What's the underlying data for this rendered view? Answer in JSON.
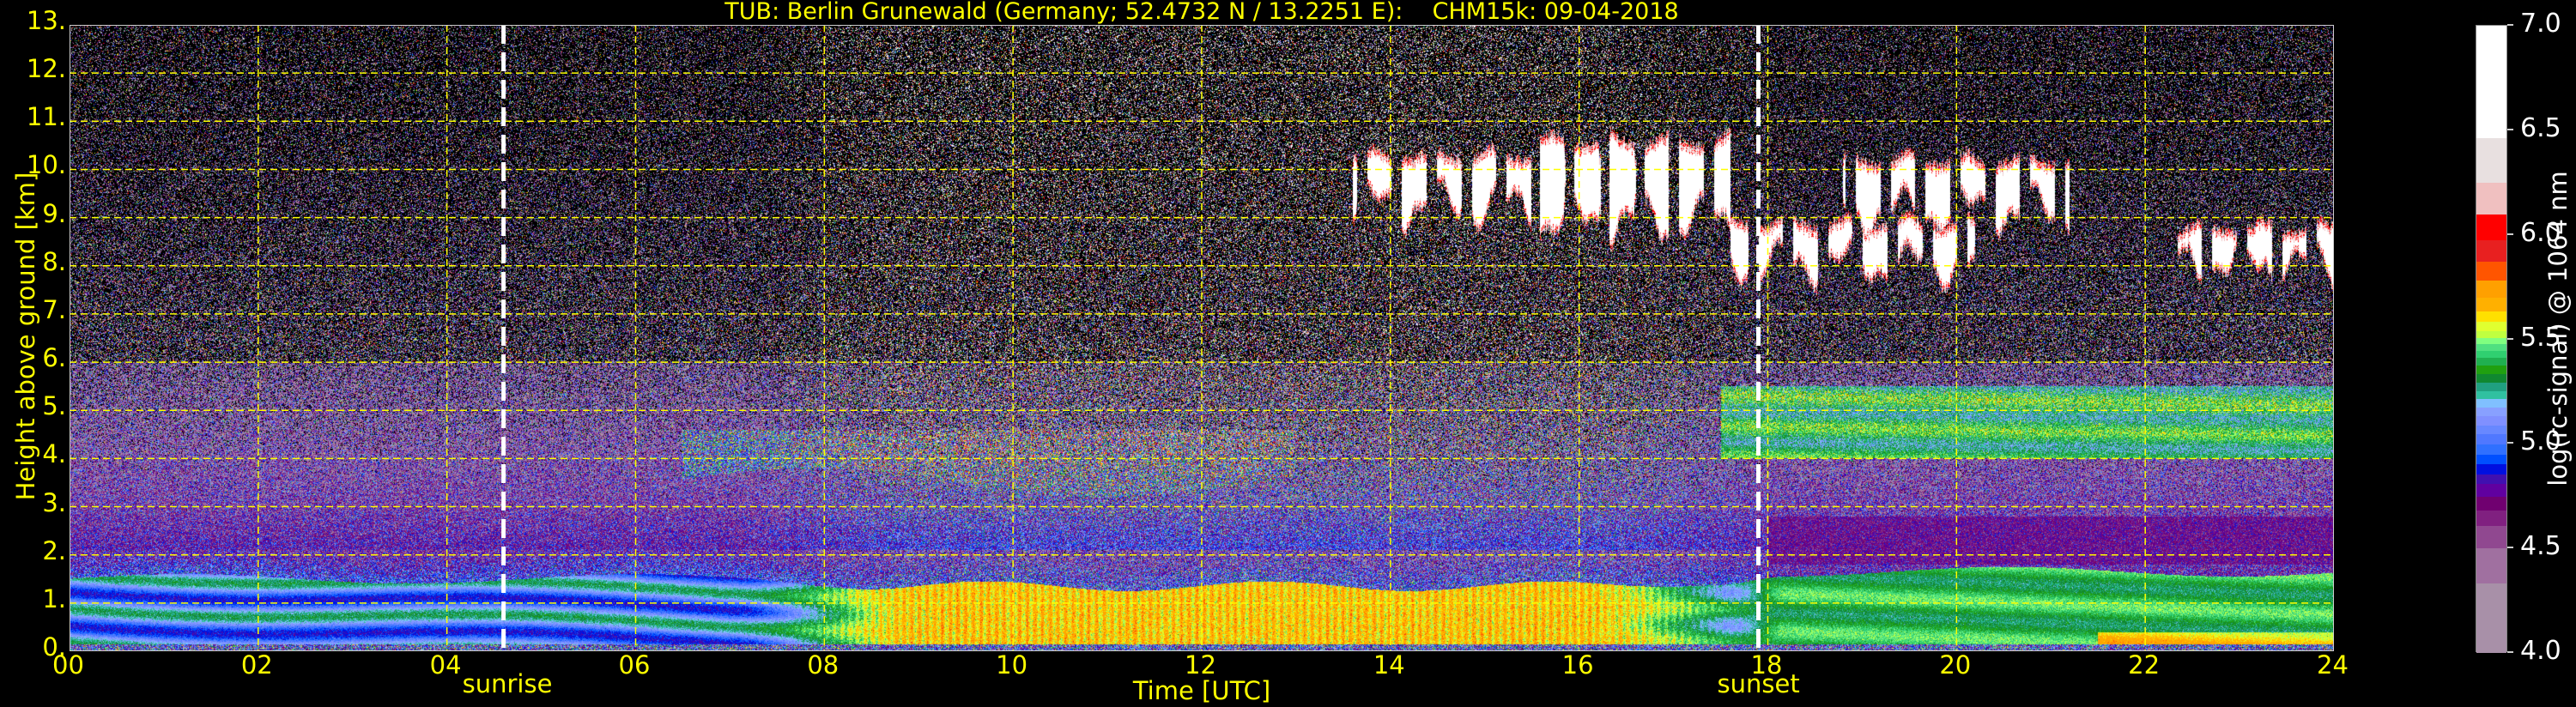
{
  "chart_data": {
    "type": "heatmap",
    "title": "TUB: Berlin Grunewald (Germany; 52.4732 N / 13.2251 E):    CHM15k: 09-04-2018",
    "xlabel": "Time [UTC]",
    "ylabel": "Height above ground [km]",
    "xlim": [
      0,
      24
    ],
    "ylim": [
      0,
      13
    ],
    "grid": true,
    "xticks": [
      0,
      2,
      4,
      6,
      8,
      10,
      12,
      14,
      16,
      18,
      20,
      22,
      24
    ],
    "xtick_labels": [
      "00",
      "02",
      "04",
      "06",
      "08",
      "10",
      "12",
      "14",
      "16",
      "18",
      "20",
      "22",
      "24"
    ],
    "yticks": [
      0,
      1,
      2,
      3,
      4,
      5,
      6,
      7,
      8,
      9,
      10,
      11,
      12,
      13
    ],
    "ytick_labels": [
      "0.",
      "1.",
      "2.",
      "3.",
      "4.",
      "5.",
      "6.",
      "7.",
      "8.",
      "9.",
      "10.",
      "11.",
      "12.",
      "13."
    ],
    "annotations": [
      {
        "label": "sunrise",
        "x": 4.6
      },
      {
        "label": "sunset",
        "x": 17.9
      }
    ],
    "colorbar": {
      "label": "log(rc-signal) @ 1064 nm",
      "vmin": 4.0,
      "vmax": 7.0,
      "ticks": [
        4.0,
        4.5,
        5.0,
        5.5,
        6.0,
        6.5,
        7.0
      ],
      "tick_labels": [
        "4.0",
        "4.5",
        "5.0",
        "5.5",
        "6.0",
        "6.5",
        "7.0"
      ],
      "bounds": [
        4.0,
        4.335,
        4.503,
        4.611,
        4.684,
        4.749,
        4.809,
        4.857,
        4.904,
        4.952,
        5.0,
        5.047,
        5.09,
        5.133,
        5.176,
        5.215,
        5.254,
        5.293,
        5.336,
        5.375,
        5.414,
        5.446,
        5.478,
        5.509,
        5.543,
        5.586,
        5.634,
        5.7,
        5.785,
        5.873,
        5.975,
        6.098,
        6.249,
        6.465,
        7.0
      ],
      "colors": [
        "#a890a8",
        "#a070a0",
        "#904890",
        "#802080",
        "#700070",
        "#6000a0",
        "#4010b0",
        "#0010e0",
        "#0050ff",
        "#3070ff",
        "#5078ff",
        "#6888ff",
        "#8090ff",
        "#88a0ff",
        "#80c0ff",
        "#30c0a0",
        "#20a080",
        "#108830",
        "#20a010",
        "#20b050",
        "#30d070",
        "#50e080",
        "#80ff80",
        "#c0ff40",
        "#e0ff30",
        "#ffe000",
        "#ffb000",
        "#ffa000",
        "#ff5500",
        "#e82020",
        "#ff0000",
        "#f0c0c0",
        "#e8e0e0",
        "#ffffff"
      ]
    },
    "features": {
      "boundary_layer_top_km": {
        "night": 1.5,
        "day": 1.4,
        "evening": 1.6
      },
      "boundary_layer_day_signal": 5.65,
      "boundary_layer_night_signal": 5.1,
      "elevated_aerosol_layer": {
        "t_start": 17.5,
        "t_end": 24,
        "bottom_km": 4.0,
        "top_km": 5.5,
        "signal": 5.35
      },
      "morning_aerosol_layer": {
        "t_start": 6.5,
        "t_end": 13,
        "bottom_km": 3.5,
        "top_km": 4.6,
        "signal": 5.15
      },
      "clouds": [
        {
          "t_start": 13.6,
          "t_end": 16.6,
          "base_km": 9.1,
          "top_km": 10.6
        },
        {
          "t_start": 15.5,
          "t_end": 17.6,
          "base_km": 8.8,
          "top_km": 10.9
        },
        {
          "t_start": 17.6,
          "t_end": 20.2,
          "base_km": 7.9,
          "top_km": 9.2
        },
        {
          "t_start": 18.8,
          "t_end": 21.2,
          "base_km": 9.0,
          "top_km": 10.5
        },
        {
          "t_start": 22.3,
          "t_end": 24,
          "base_km": 7.9,
          "top_km": 9.1
        }
      ]
    }
  }
}
